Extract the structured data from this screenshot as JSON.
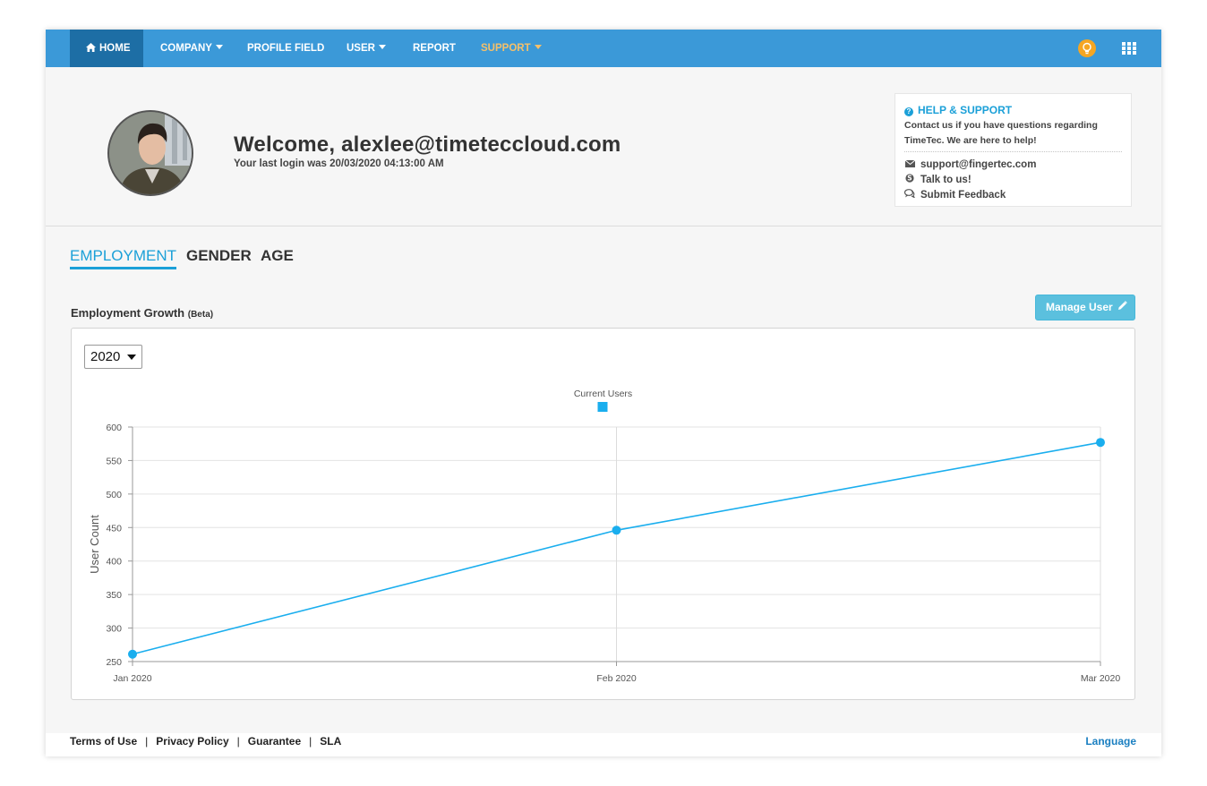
{
  "nav": {
    "home": "HOME",
    "company": "COMPANY",
    "profile_field": "PROFILE FIELD",
    "user": "USER",
    "report": "REPORT",
    "support": "SUPPORT",
    "right_icons": [
      "lightbulb-icon",
      "apps-grid-icon"
    ]
  },
  "header": {
    "welcome": "Welcome, alexlee@timeteccloud.com",
    "last_login": "Your last login was 20/03/2020 04:13:00 AM"
  },
  "help": {
    "title": "HELP & SUPPORT",
    "text": "Contact us if you have questions regarding TimeTec. We are here to help!",
    "email": "support@fingertec.com",
    "talk": "Talk to us!",
    "feedback": "Submit Feedback"
  },
  "tabs": [
    "EMPLOYMENT",
    "GENDER",
    "AGE"
  ],
  "section": {
    "title": "Employment Growth",
    "beta": "(Beta)",
    "manage_button": "Manage User",
    "year_selected": "2020"
  },
  "chart_data": {
    "type": "line",
    "categories": [
      "Jan 2020",
      "Feb 2020",
      "Mar 2020"
    ],
    "series": [
      {
        "name": "Current Users",
        "values": [
          261,
          446,
          577
        ],
        "color": "#1aaeee"
      }
    ],
    "ylabel": "User Count",
    "xlabel": "",
    "ylim": [
      250,
      600
    ],
    "yticks": [
      250,
      300,
      350,
      400,
      450,
      500,
      550,
      600
    ],
    "grid": true,
    "legend": "top-center"
  },
  "footer": {
    "links": [
      "Terms of Use",
      "Privacy Policy",
      "Guarantee",
      "SLA"
    ],
    "language": "Language"
  },
  "colors": {
    "nav_bg": "#3b99d8",
    "nav_active": "#1d6ea5",
    "accent": "#1ba0d8",
    "support": "#f5c06a",
    "button": "#5bc0de"
  }
}
